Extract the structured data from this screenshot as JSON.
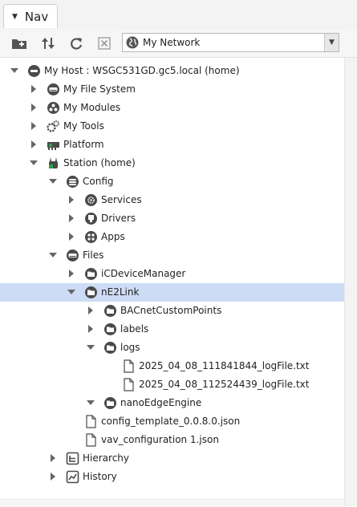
{
  "tab": {
    "label": "Nav"
  },
  "toolbar": {
    "buttons": [
      {
        "icon": "new-folder-icon"
      },
      {
        "icon": "sort-icon"
      },
      {
        "icon": "refresh-icon"
      },
      {
        "icon": "close-icon"
      }
    ],
    "network_select": {
      "value": "My Network",
      "icon": "globe-icon"
    }
  },
  "colors": {
    "selection": "#cddcf5",
    "icon_dark": "#4a4a4a"
  },
  "tree": [
    {
      "label": "My Host : WSGC531GD.gc5.local (home)",
      "depth": 0,
      "toggle": "expanded",
      "icon": "host-icon"
    },
    {
      "label": "My File System",
      "depth": 1,
      "toggle": "collapsed",
      "icon": "drive-icon"
    },
    {
      "label": "My Modules",
      "depth": 1,
      "toggle": "collapsed",
      "icon": "modules-icon"
    },
    {
      "label": "My Tools",
      "depth": 1,
      "toggle": "collapsed",
      "icon": "tools-icon"
    },
    {
      "label": "Platform",
      "depth": 1,
      "toggle": "collapsed",
      "icon": "platform-icon"
    },
    {
      "label": "Station (home)",
      "depth": 1,
      "toggle": "expanded",
      "icon": "station-icon"
    },
    {
      "label": "Config",
      "depth": 2,
      "toggle": "expanded",
      "icon": "database-icon"
    },
    {
      "label": "Services",
      "depth": 3,
      "toggle": "collapsed",
      "icon": "services-icon"
    },
    {
      "label": "Drivers",
      "depth": 3,
      "toggle": "collapsed",
      "icon": "drivers-icon"
    },
    {
      "label": "Apps",
      "depth": 3,
      "toggle": "collapsed",
      "icon": "apps-icon"
    },
    {
      "label": "Files",
      "depth": 2,
      "toggle": "expanded",
      "icon": "drive-icon"
    },
    {
      "label": "iCDeviceManager",
      "depth": 3,
      "toggle": "collapsed",
      "icon": "folder-icon"
    },
    {
      "label": "nE2Link",
      "depth": 3,
      "toggle": "expanded",
      "icon": "folder-icon",
      "selected": true
    },
    {
      "label": "BACnetCustomPoints",
      "depth": 4,
      "toggle": "collapsed",
      "icon": "folder-icon"
    },
    {
      "label": "labels",
      "depth": 4,
      "toggle": "collapsed",
      "icon": "folder-icon"
    },
    {
      "label": "logs",
      "depth": 4,
      "toggle": "expanded",
      "icon": "folder-icon"
    },
    {
      "label": "2025_04_08_111841844_logFile.txt",
      "depth": 5,
      "toggle": "none",
      "icon": "file-icon"
    },
    {
      "label": "2025_04_08_112524439_logFile.txt",
      "depth": 5,
      "toggle": "none",
      "icon": "file-icon"
    },
    {
      "label": "nanoEdgeEngine",
      "depth": 4,
      "toggle": "expanded",
      "icon": "folder-icon"
    },
    {
      "label": "config_template_0.0.8.0.json",
      "depth": 3,
      "toggle": "none",
      "icon": "file-icon"
    },
    {
      "label": "vav_configuration 1.json",
      "depth": 3,
      "toggle": "none",
      "icon": "file-icon"
    },
    {
      "label": "Hierarchy",
      "depth": 2,
      "toggle": "collapsed",
      "icon": "hierarchy-icon"
    },
    {
      "label": "History",
      "depth": 2,
      "toggle": "collapsed",
      "icon": "history-icon"
    }
  ]
}
